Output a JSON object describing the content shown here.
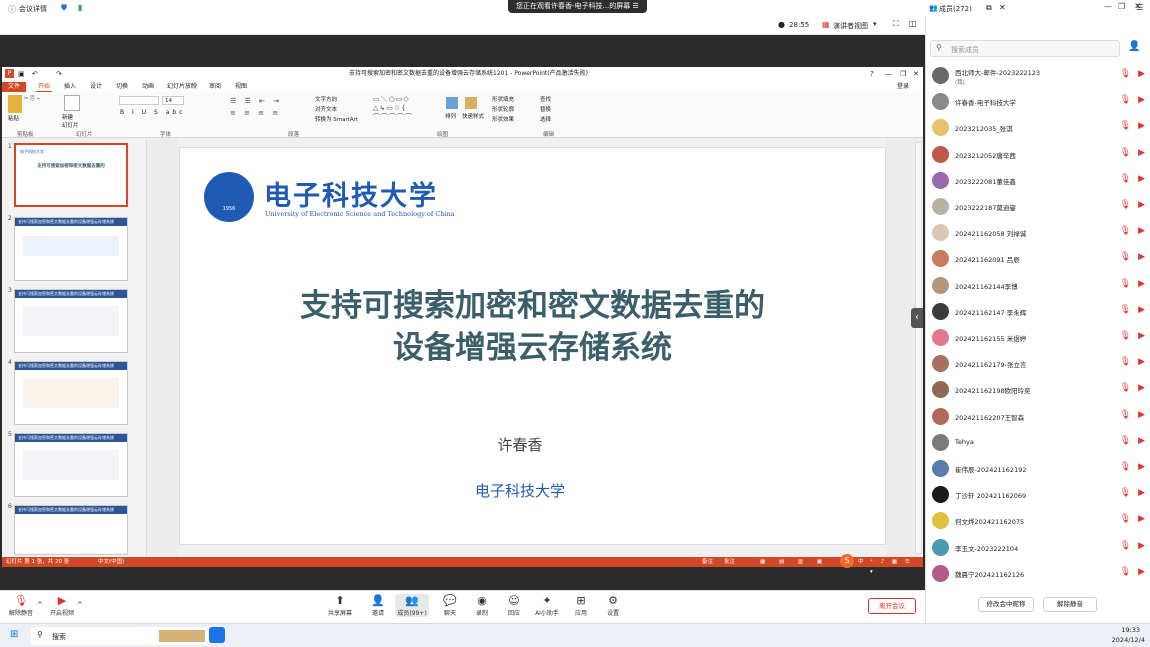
{
  "top_bar": {
    "meeting_details": "会议详情",
    "banner": "您正在观看许春香-电子科技...的屏幕",
    "time": "28:55",
    "view_mode": "演讲者视图",
    "members_title": "成员(272)"
  },
  "ppt": {
    "title": "支持可搜索加密和密文数据去重的设备增强云存储系统1201 - PowerPoint(产品激活失败)",
    "login": "登录",
    "tabs": [
      "文件",
      "开始",
      "插入",
      "设计",
      "切换",
      "动画",
      "幻灯片放映",
      "审阅",
      "视图"
    ],
    "ribbon_groups": [
      "剪贴板",
      "幻灯片",
      "字体",
      "段落",
      "绘图",
      "编辑"
    ],
    "ribbon": {
      "paste": "粘贴",
      "new_slide": "新建\n幻灯片",
      "font_size": "14",
      "direction": "文字方向",
      "align": "对齐文本",
      "smartart": "转换为 SmartArt",
      "arrange": "排列",
      "styles": "快速样式",
      "fill": "形状填充",
      "outline": "形状轮廓",
      "effect": "形状效果",
      "find": "查找",
      "replace": "替换",
      "select": "选择"
    },
    "thumb_titles": [
      "支持可搜索加密和密文数据去重的设备增强云存储系统",
      "支持可搜索加密和密文数据去重的设备增强云存储系统",
      "支持可搜索加密和密文数据去重的设备增强云存储系统",
      "支持可搜索加密和密文数据去重的设备增强云存储系统",
      "支持可搜索加密和密文数据去重的设备增强云存储系统"
    ],
    "thumb_nums": [
      "1",
      "2",
      "3",
      "4",
      "5",
      "6"
    ],
    "slide": {
      "uni_cn": "电子科技大学",
      "uni_en": "University of Electronic Science and Technology of China",
      "seal_year": "1956",
      "title_l1": "支持可搜索加密和密文数据去重的",
      "title_l2": "设备增强云存储系统",
      "author": "许春香",
      "affiliation": "电子科技大学"
    },
    "status_left": "幻灯片 第 1 张，共 20 张",
    "status_lang": "中文(中国)",
    "status_notes": "备注",
    "status_comments": "批注",
    "ime": "中"
  },
  "controls": {
    "mute": "解除静音",
    "video": "开启视频",
    "share": "共享屏幕",
    "invite": "邀请",
    "members": "成员(99+)",
    "chat": "聊天",
    "record": "录制",
    "reactions": "回应",
    "ai": "AI小助手",
    "apps": "应用",
    "settings": "设置",
    "leave": "离开会议"
  },
  "side": {
    "search_placeholder": "搜索成员",
    "members": [
      {
        "name": "西北师大-邮件-2023222123",
        "sub": "(我)",
        "color": "#6a6a6a"
      },
      {
        "name": "许春香-电子科技大学",
        "sub": "",
        "color": "#8a8a8a"
      },
      {
        "name": "2023212035_张淇",
        "sub": "",
        "color": "#e8c16b"
      },
      {
        "name": "2023212052唐辛茜",
        "sub": "",
        "color": "#c0584a"
      },
      {
        "name": "2023222081董佳鑫",
        "sub": "",
        "color": "#9a6ab0"
      },
      {
        "name": "2023222187莫逍鋆",
        "sub": "",
        "color": "#b8b0a0"
      },
      {
        "name": "202421162058 刘禄诚",
        "sub": "",
        "color": "#d9c8b5"
      },
      {
        "name": "202421162091 吕辰",
        "sub": "",
        "color": "#c77d5d"
      },
      {
        "name": "202421162144李博",
        "sub": "",
        "color": "#b5967a"
      },
      {
        "name": "202421162147 李永辉",
        "sub": "",
        "color": "#3b3b3b"
      },
      {
        "name": "202421162155 米煜婷",
        "sub": "",
        "color": "#e07a8a"
      },
      {
        "name": "202421162179-张立言",
        "sub": "",
        "color": "#a87060"
      },
      {
        "name": "202421162198欧阳玲奕",
        "sub": "",
        "color": "#8f6a50"
      },
      {
        "name": "202421162207王智森",
        "sub": "",
        "color": "#b06a5a"
      },
      {
        "name": "Tehya",
        "sub": "",
        "color": "#7a7a7a"
      },
      {
        "name": "崔伟辰-202421162192",
        "sub": "",
        "color": "#5a7ab0"
      },
      {
        "name": "丁沙轩 202421162069",
        "sub": "",
        "color": "#1a1a1a"
      },
      {
        "name": "何文烨202421162075",
        "sub": "",
        "color": "#e0c040"
      },
      {
        "name": "李玉文-2023222104",
        "sub": "",
        "color": "#4a9ab0"
      },
      {
        "name": "魏晨宁202421162126",
        "sub": "",
        "color": "#b05a8a"
      }
    ],
    "modify_name": "修改会中昵称",
    "unmute_request": "解除静音"
  },
  "taskbar": {
    "search": "搜索",
    "time": "19:33",
    "date": "2024/12/4"
  },
  "colors": {
    "ppt_red": "#d24726",
    "slide_title": "#3a5f6b",
    "slide_blue": "#1f5bb5",
    "brand_blue": "#1a73e8",
    "leave_red": "#e0342c"
  }
}
